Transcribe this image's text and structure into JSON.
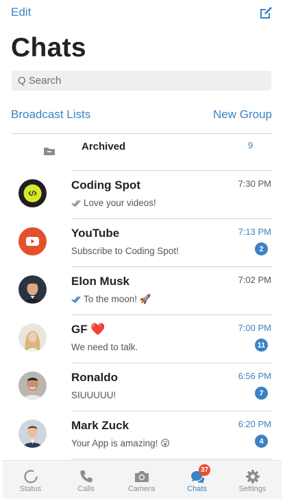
{
  "header": {
    "edit_label": "Edit",
    "compose_icon": "compose-icon",
    "title": "Chats"
  },
  "search": {
    "placeholder": "Q Search"
  },
  "links": {
    "broadcast": "Broadcast Lists",
    "new_group": "New Group"
  },
  "archived": {
    "label": "Archived",
    "count": "9"
  },
  "chats": [
    {
      "name": "Coding Spot",
      "message": "Love your videos!",
      "time": "7:30 PM",
      "unread": "",
      "read_receipt": "gray-check"
    },
    {
      "name": "YouTube",
      "message": "Subscribe to Coding Spot!",
      "time": "7:13 PM",
      "unread": "2",
      "read_receipt": ""
    },
    {
      "name": "Elon Musk",
      "message": "To the moon! 🚀",
      "time": "7:02 PM",
      "unread": "",
      "read_receipt": "blue-check"
    },
    {
      "name": "GF ❤️",
      "message": "We need to talk.",
      "time": "7:00 PM",
      "unread": "11",
      "read_receipt": ""
    },
    {
      "name": "Ronaldo",
      "message": "SIUUUUU!",
      "time": "6:56 PM",
      "unread": "7",
      "read_receipt": ""
    },
    {
      "name": "Mark Zuck",
      "message": "Your App is amazing! 😮",
      "time": "6:20 PM",
      "unread": "4",
      "read_receipt": ""
    }
  ],
  "tabs": [
    {
      "label": "Status",
      "icon": "status-icon"
    },
    {
      "label": "Calls",
      "icon": "phone-icon"
    },
    {
      "label": "Camera",
      "icon": "camera-icon"
    },
    {
      "label": "Chats",
      "icon": "chats-icon",
      "badge": "37"
    },
    {
      "label": "Settings",
      "icon": "gear-icon"
    }
  ],
  "colors": {
    "accent": "#3b82c4",
    "badge_red": "#e5502f",
    "youtube": "#e4502c",
    "coding_spot_bg": "#1f1f1f",
    "coding_spot_fg": "#d6ea2b"
  }
}
